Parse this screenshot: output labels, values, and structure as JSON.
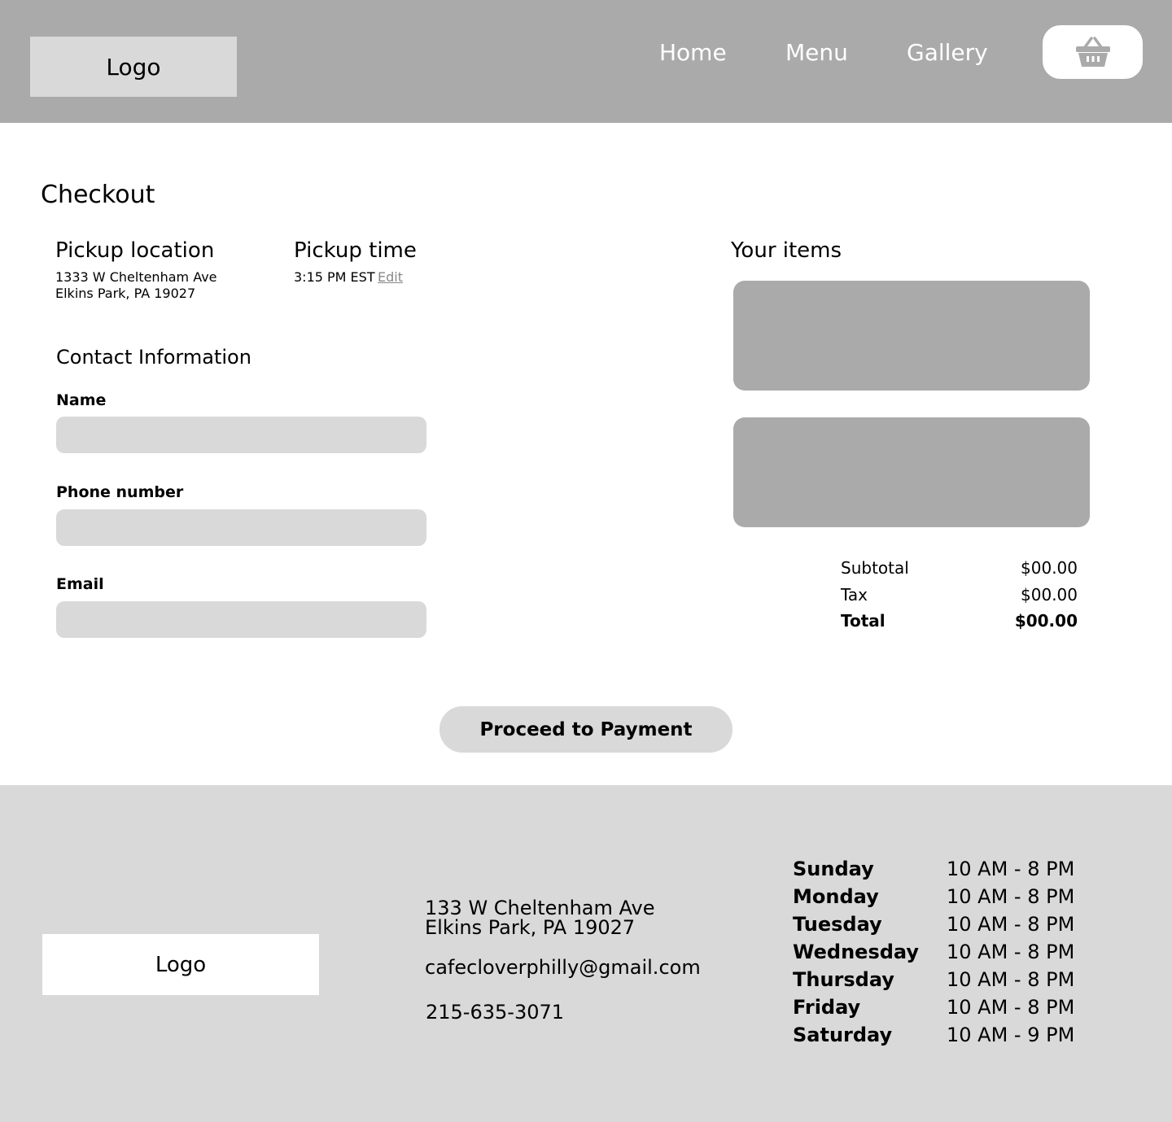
{
  "header": {
    "logo": "Logo",
    "nav": [
      {
        "label": "Home"
      },
      {
        "label": "Menu"
      },
      {
        "label": "Gallery"
      }
    ],
    "cart_icon": "basket-icon"
  },
  "checkout": {
    "title": "Checkout",
    "pickup_location": {
      "heading": "Pickup location",
      "line1": "1333 W Cheltenham Ave",
      "line2": "Elkins Park, PA 19027"
    },
    "pickup_time": {
      "heading": "Pickup time",
      "value": "3:15 PM EST",
      "edit_label": "Edit"
    },
    "contact": {
      "heading": "Contact Information",
      "fields": [
        {
          "label": "Name",
          "value": "",
          "placeholder": ""
        },
        {
          "label": "Phone number",
          "value": "",
          "placeholder": ""
        },
        {
          "label": "Email",
          "value": "",
          "placeholder": ""
        }
      ]
    },
    "items": {
      "heading": "Your items"
    },
    "summary": {
      "subtotal_label": "Subtotal",
      "subtotal_value": "$00.00",
      "tax_label": "Tax",
      "tax_value": "$00.00",
      "total_label": "Total",
      "total_value": "$00.00"
    },
    "proceed_label": "Proceed to Payment"
  },
  "footer": {
    "logo": "Logo",
    "address_line1": "133 W Cheltenham Ave",
    "address_line2": "Elkins Park, PA 19027",
    "email": "cafecloverphilly@gmail.com",
    "phone": "215-635-3071",
    "hours": [
      {
        "day": "Sunday",
        "time": "10 AM - 8 PM"
      },
      {
        "day": "Monday",
        "time": "10 AM - 8 PM"
      },
      {
        "day": "Tuesday",
        "time": "10 AM - 8 PM"
      },
      {
        "day": "Wednesday",
        "time": "10 AM - 8 PM"
      },
      {
        "day": "Thursday",
        "time": "10 AM - 8 PM"
      },
      {
        "day": "Friday",
        "time": "10 AM - 8 PM"
      },
      {
        "day": "Saturday",
        "time": "10 AM - 9 PM"
      }
    ]
  },
  "colors": {
    "header_bg": "#aaaaaa",
    "placeholder_gray": "#d9d9d9",
    "card_gray": "#aaaaaa",
    "link_gray": "#888888"
  }
}
